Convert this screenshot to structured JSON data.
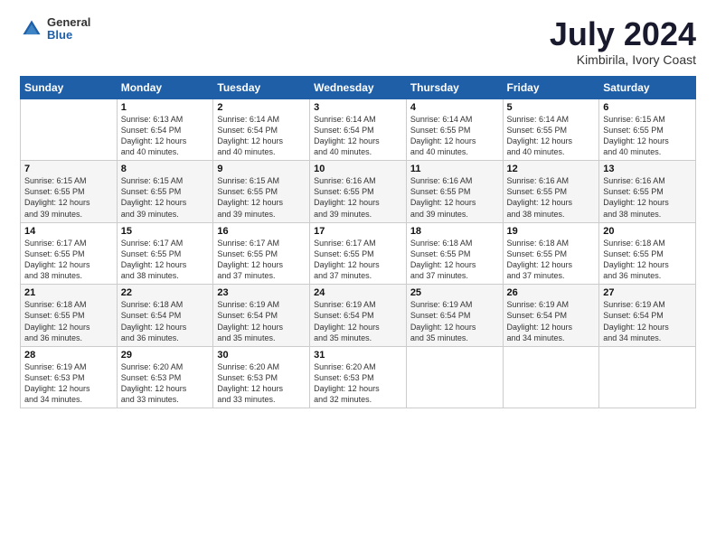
{
  "logo": {
    "line1": "General",
    "line2": "Blue"
  },
  "title": "July 2024",
  "location": "Kimbirila, Ivory Coast",
  "weekdays": [
    "Sunday",
    "Monday",
    "Tuesday",
    "Wednesday",
    "Thursday",
    "Friday",
    "Saturday"
  ],
  "weeks": [
    [
      {
        "day": "",
        "text": ""
      },
      {
        "day": "1",
        "text": "Sunrise: 6:13 AM\nSunset: 6:54 PM\nDaylight: 12 hours\nand 40 minutes."
      },
      {
        "day": "2",
        "text": "Sunrise: 6:14 AM\nSunset: 6:54 PM\nDaylight: 12 hours\nand 40 minutes."
      },
      {
        "day": "3",
        "text": "Sunrise: 6:14 AM\nSunset: 6:54 PM\nDaylight: 12 hours\nand 40 minutes."
      },
      {
        "day": "4",
        "text": "Sunrise: 6:14 AM\nSunset: 6:55 PM\nDaylight: 12 hours\nand 40 minutes."
      },
      {
        "day": "5",
        "text": "Sunrise: 6:14 AM\nSunset: 6:55 PM\nDaylight: 12 hours\nand 40 minutes."
      },
      {
        "day": "6",
        "text": "Sunrise: 6:15 AM\nSunset: 6:55 PM\nDaylight: 12 hours\nand 40 minutes."
      }
    ],
    [
      {
        "day": "7",
        "text": "Sunrise: 6:15 AM\nSunset: 6:55 PM\nDaylight: 12 hours\nand 39 minutes."
      },
      {
        "day": "8",
        "text": "Sunrise: 6:15 AM\nSunset: 6:55 PM\nDaylight: 12 hours\nand 39 minutes."
      },
      {
        "day": "9",
        "text": "Sunrise: 6:15 AM\nSunset: 6:55 PM\nDaylight: 12 hours\nand 39 minutes."
      },
      {
        "day": "10",
        "text": "Sunrise: 6:16 AM\nSunset: 6:55 PM\nDaylight: 12 hours\nand 39 minutes."
      },
      {
        "day": "11",
        "text": "Sunrise: 6:16 AM\nSunset: 6:55 PM\nDaylight: 12 hours\nand 39 minutes."
      },
      {
        "day": "12",
        "text": "Sunrise: 6:16 AM\nSunset: 6:55 PM\nDaylight: 12 hours\nand 38 minutes."
      },
      {
        "day": "13",
        "text": "Sunrise: 6:16 AM\nSunset: 6:55 PM\nDaylight: 12 hours\nand 38 minutes."
      }
    ],
    [
      {
        "day": "14",
        "text": "Sunrise: 6:17 AM\nSunset: 6:55 PM\nDaylight: 12 hours\nand 38 minutes."
      },
      {
        "day": "15",
        "text": "Sunrise: 6:17 AM\nSunset: 6:55 PM\nDaylight: 12 hours\nand 38 minutes."
      },
      {
        "day": "16",
        "text": "Sunrise: 6:17 AM\nSunset: 6:55 PM\nDaylight: 12 hours\nand 37 minutes."
      },
      {
        "day": "17",
        "text": "Sunrise: 6:17 AM\nSunset: 6:55 PM\nDaylight: 12 hours\nand 37 minutes."
      },
      {
        "day": "18",
        "text": "Sunrise: 6:18 AM\nSunset: 6:55 PM\nDaylight: 12 hours\nand 37 minutes."
      },
      {
        "day": "19",
        "text": "Sunrise: 6:18 AM\nSunset: 6:55 PM\nDaylight: 12 hours\nand 37 minutes."
      },
      {
        "day": "20",
        "text": "Sunrise: 6:18 AM\nSunset: 6:55 PM\nDaylight: 12 hours\nand 36 minutes."
      }
    ],
    [
      {
        "day": "21",
        "text": "Sunrise: 6:18 AM\nSunset: 6:55 PM\nDaylight: 12 hours\nand 36 minutes."
      },
      {
        "day": "22",
        "text": "Sunrise: 6:18 AM\nSunset: 6:54 PM\nDaylight: 12 hours\nand 36 minutes."
      },
      {
        "day": "23",
        "text": "Sunrise: 6:19 AM\nSunset: 6:54 PM\nDaylight: 12 hours\nand 35 minutes."
      },
      {
        "day": "24",
        "text": "Sunrise: 6:19 AM\nSunset: 6:54 PM\nDaylight: 12 hours\nand 35 minutes."
      },
      {
        "day": "25",
        "text": "Sunrise: 6:19 AM\nSunset: 6:54 PM\nDaylight: 12 hours\nand 35 minutes."
      },
      {
        "day": "26",
        "text": "Sunrise: 6:19 AM\nSunset: 6:54 PM\nDaylight: 12 hours\nand 34 minutes."
      },
      {
        "day": "27",
        "text": "Sunrise: 6:19 AM\nSunset: 6:54 PM\nDaylight: 12 hours\nand 34 minutes."
      }
    ],
    [
      {
        "day": "28",
        "text": "Sunrise: 6:19 AM\nSunset: 6:53 PM\nDaylight: 12 hours\nand 34 minutes."
      },
      {
        "day": "29",
        "text": "Sunrise: 6:20 AM\nSunset: 6:53 PM\nDaylight: 12 hours\nand 33 minutes."
      },
      {
        "day": "30",
        "text": "Sunrise: 6:20 AM\nSunset: 6:53 PM\nDaylight: 12 hours\nand 33 minutes."
      },
      {
        "day": "31",
        "text": "Sunrise: 6:20 AM\nSunset: 6:53 PM\nDaylight: 12 hours\nand 32 minutes."
      },
      {
        "day": "",
        "text": ""
      },
      {
        "day": "",
        "text": ""
      },
      {
        "day": "",
        "text": ""
      }
    ]
  ]
}
